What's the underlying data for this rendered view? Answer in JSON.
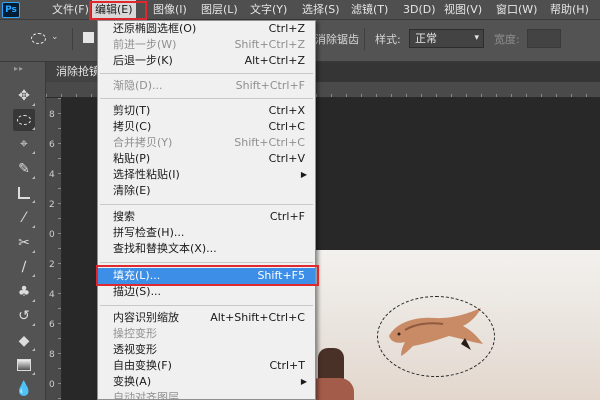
{
  "app": {
    "logo": "Ps"
  },
  "menubar": {
    "items": [
      "文件(F)",
      "编辑(E)",
      "图像(I)",
      "图层(L)",
      "文字(Y)",
      "选择(S)",
      "滤镜(T)",
      "3D(D)",
      "视图(V)",
      "窗口(W)",
      "帮助(H)"
    ],
    "active": "编辑(E)"
  },
  "options": {
    "antialias_label": "消除锯齿",
    "style_label": "样式:",
    "style_value": "正常",
    "width_label": "宽度:"
  },
  "document": {
    "tab_title": "消除抢镜"
  },
  "rulers": {
    "left_numbers": [
      "8",
      "6",
      "4",
      "2",
      "0",
      "2",
      "4",
      "6",
      "8",
      "0"
    ]
  },
  "edit_menu": {
    "items": [
      {
        "label": "还原椭圆选框(O)",
        "shortcut": "Ctrl+Z",
        "disabled": false
      },
      {
        "label": "前进一步(W)",
        "shortcut": "Shift+Ctrl+Z",
        "disabled": true
      },
      {
        "label": "后退一步(K)",
        "shortcut": "Alt+Ctrl+Z",
        "disabled": false
      },
      {
        "label": "渐隐(D)...",
        "shortcut": "Shift+Ctrl+F",
        "disabled": true
      },
      {
        "label": "剪切(T)",
        "shortcut": "Ctrl+X",
        "disabled": false
      },
      {
        "label": "拷贝(C)",
        "shortcut": "Ctrl+C",
        "disabled": false
      },
      {
        "label": "合并拷贝(Y)",
        "shortcut": "Shift+Ctrl+C",
        "disabled": true
      },
      {
        "label": "粘贴(P)",
        "shortcut": "Ctrl+V",
        "disabled": false
      },
      {
        "label": "选择性粘贴(I)",
        "shortcut": "▶",
        "disabled": false
      },
      {
        "label": "清除(E)",
        "shortcut": "",
        "disabled": false
      },
      {
        "label": "搜索",
        "shortcut": "Ctrl+F",
        "disabled": false
      },
      {
        "label": "拼写检查(H)...",
        "shortcut": "",
        "disabled": false
      },
      {
        "label": "查找和替换文本(X)...",
        "shortcut": "",
        "disabled": false
      },
      {
        "label": "填充(L)...",
        "shortcut": "Shift+F5",
        "disabled": false,
        "highlighted": true
      },
      {
        "label": "描边(S)...",
        "shortcut": "",
        "disabled": false
      },
      {
        "label": "内容识别缩放",
        "shortcut": "Alt+Shift+Ctrl+C",
        "disabled": false
      },
      {
        "label": "操控变形",
        "shortcut": "",
        "disabled": true
      },
      {
        "label": "透视变形",
        "shortcut": "",
        "disabled": false
      },
      {
        "label": "自由变换(F)",
        "shortcut": "Ctrl+T",
        "disabled": false
      },
      {
        "label": "变换(A)",
        "shortcut": "▶",
        "disabled": false
      },
      {
        "label": "自动对齐图层",
        "shortcut": "",
        "disabled": true
      }
    ]
  },
  "tools": [
    "move-icon",
    "elliptical-marquee-icon",
    "quick-select-icon",
    "healing-brush-icon",
    "crop-icon",
    "eyedropper-icon",
    "patch-icon",
    "brush-icon",
    "clone-stamp-icon",
    "history-brush-icon",
    "eraser-icon",
    "gradient-icon",
    "blur-icon"
  ],
  "colors": {
    "accent_highlight": "#3d8ee6",
    "annotation_red": "#e0292e",
    "ps_blue": "#31a8ff"
  }
}
